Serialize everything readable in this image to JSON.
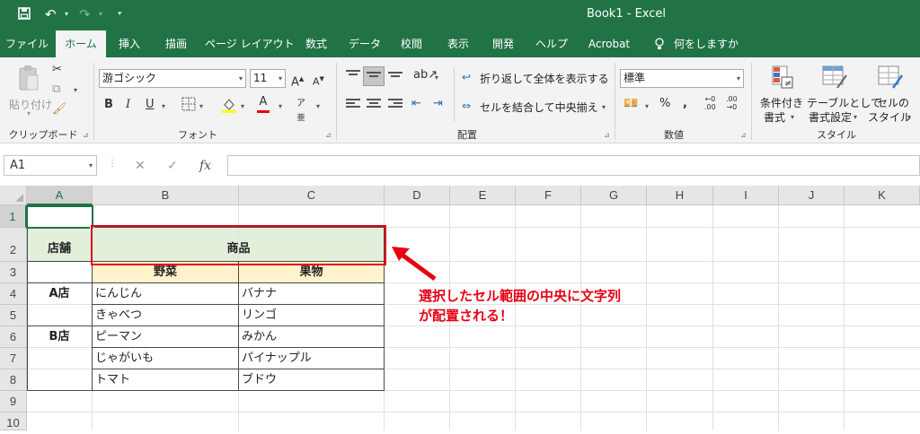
{
  "window": {
    "title": "Book1  -  Excel"
  },
  "menu": {
    "tabs": [
      "ファイル",
      "ホーム",
      "挿入",
      "描画",
      "ページ レイアウト",
      "数式",
      "データ",
      "校閲",
      "表示",
      "開発",
      "ヘルプ",
      "Acrobat",
      "何をしますか"
    ],
    "active": "ホーム"
  },
  "ribbon": {
    "clipboard": {
      "paste": "貼り付け",
      "label": "クリップボード"
    },
    "font": {
      "name": "游ゴシック",
      "size": "11",
      "label": "フォント"
    },
    "alignment": {
      "wrap": "折り返して全体を表示する",
      "merge": "セルを結合して中央揃え",
      "label": "配置"
    },
    "number": {
      "format": "標準",
      "label": "数値"
    },
    "styles": {
      "conditional": [
        "条件付き",
        "書式"
      ],
      "table": [
        "テーブルとして",
        "書式設定"
      ],
      "cell": [
        "セルの",
        "スタイル"
      ],
      "label": "スタイル"
    }
  },
  "formula_bar": {
    "name_box": "A1",
    "fx": "fx",
    "content": ""
  },
  "sheet": {
    "columns": [
      "A",
      "B",
      "C",
      "D",
      "E",
      "F",
      "G",
      "H",
      "I",
      "J",
      "K"
    ],
    "rows": [
      "1",
      "2",
      "3",
      "4",
      "5",
      "6",
      "7",
      "8",
      "9",
      "10"
    ],
    "cells": {
      "A2": "店舗",
      "B2": "商品",
      "B3": "野菜",
      "C3": "果物",
      "A4": "A店",
      "B4": "にんじん",
      "C4": "バナナ",
      "B5": "きゃべつ",
      "C5": "リンゴ",
      "A6": "B店",
      "B6": "ピーマン",
      "C6": "みかん",
      "B7": "じゃがいも",
      "C7": "パイナップル",
      "B8": "トマト",
      "C8": "ブドウ"
    }
  },
  "annotation": {
    "lines": [
      "選択したセル範囲の中央に文字列",
      "が配置される！"
    ]
  },
  "colors": {
    "excel_green": "#217346",
    "header_fill": "#e2efda",
    "subheader_fill": "#fff2cc",
    "annotation": "#e60012"
  }
}
